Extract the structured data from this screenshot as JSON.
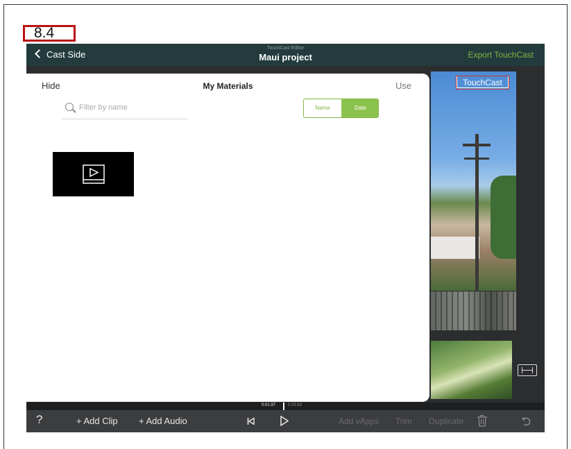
{
  "figure_label": "8.4",
  "header": {
    "back_label": "Cast Side",
    "app_title_small": "TouchCast Editor",
    "project_title": "Maui project",
    "export_label": "Export TouchCast"
  },
  "panel": {
    "hide_label": "Hide",
    "title": "My Materials",
    "use_label": "Use",
    "search_placeholder": "Filter by name",
    "sort_options": [
      "Name",
      "Date"
    ],
    "sort_selected": "Date"
  },
  "video": {
    "badge": "TouchCast"
  },
  "timeline": {
    "current_time": "0:01.97",
    "total_time": "0:23.63"
  },
  "toolbar": {
    "help": "?",
    "add_clip": "+ Add Clip",
    "add_audio": "+ Add Audio",
    "add_vapps": "Add vApps",
    "trim": "Trim",
    "duplicate": "Duplicate"
  },
  "colors": {
    "accent_green": "#7fb542",
    "topbar": "#233b3d",
    "app_bg": "#2b2d2f"
  },
  "icons": [
    "chevron-left-icon",
    "search-icon",
    "video-file-icon",
    "rewind-icon",
    "play-icon",
    "trash-icon",
    "undo-icon",
    "layout-icon"
  ]
}
